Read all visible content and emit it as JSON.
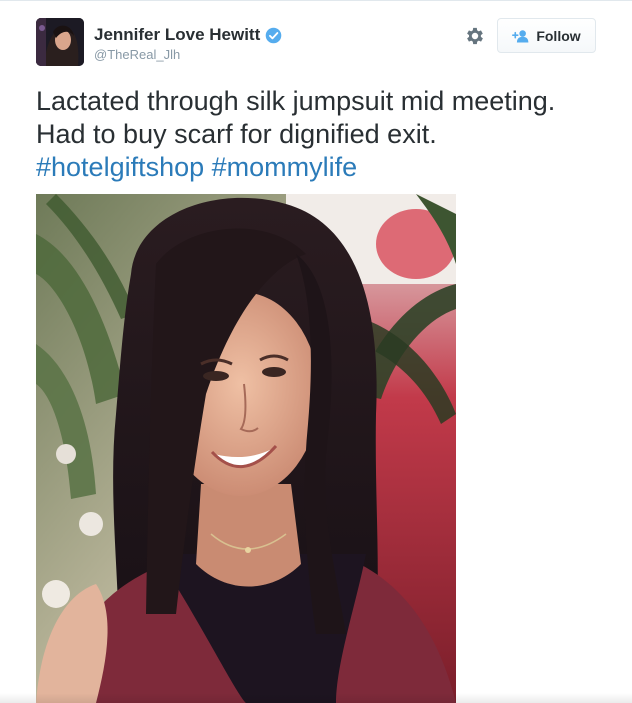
{
  "author": {
    "display_name": "Jennifer Love Hewitt",
    "handle": "@TheReal_Jlh",
    "verified": true,
    "avatar_alt": "Profile photo"
  },
  "actions": {
    "follow_label": "Follow",
    "settings_icon": "gear-icon",
    "follow_icon": "person-add-icon"
  },
  "tweet": {
    "line1": "Lactated through silk jumpsuit mid meeting.",
    "line2": "Had to buy scarf for dignified exit.",
    "hashtags": [
      "#hotelgiftshop",
      "#mommylife"
    ]
  },
  "media": {
    "type": "photo",
    "description": "Selfie photo"
  },
  "colors": {
    "text": "#292f33",
    "secondary": "#8899a6",
    "link": "#2b7bb9",
    "verified": "#55acee"
  }
}
